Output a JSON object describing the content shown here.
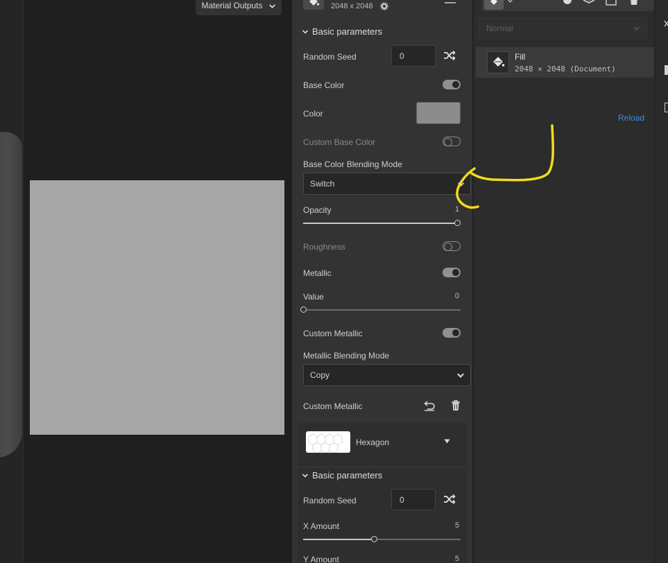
{
  "viewport": {
    "outputs_label": "Material Outputs"
  },
  "header": {
    "resolution": "2048 x 2048"
  },
  "props": {
    "basic_parameters_1": "Basic parameters",
    "random_seed_label": "Random Seed",
    "random_seed_value": "0",
    "base_color_label": "Base Color",
    "base_color_on": true,
    "color_label": "Color",
    "color_swatch": "#8c8c8c",
    "custom_base_color_label": "Custom Base Color",
    "custom_base_color_on": false,
    "base_color_blending_label": "Base Color Blending Mode",
    "base_color_blending_value": "Switch",
    "opacity_label": "Opacity",
    "opacity_value": "1",
    "opacity_fraction": 1.0,
    "roughness_label": "Roughness",
    "roughness_on": false,
    "metallic_label": "Metallic",
    "metallic_on": true,
    "value_label": "Value",
    "value_value": "0",
    "value_fraction": 0.0,
    "custom_metallic_label": "Custom Metallic",
    "custom_metallic_on": true,
    "metallic_blending_label": "Metallic Blending Mode",
    "metallic_blending_value": "Copy",
    "custom_metallic_2_label": "Custom Metallic",
    "pattern_name": "Hexagon",
    "basic_parameters_2": "Basic parameters",
    "random_seed_2_label": "Random Seed",
    "random_seed_2_value": "0",
    "x_amount_label": "X Amount",
    "x_amount_value": "5",
    "x_amount_fraction": 0.45,
    "y_amount_label": "Y Amount",
    "y_amount_value": "5"
  },
  "layers": {
    "blend_mode": "Normal",
    "layer_name": "Fill",
    "layer_detail": "2048 × 2048 (Document)",
    "reload_label": "Reload"
  },
  "colors": {
    "accent_link": "#3b8ddb",
    "annotation": "#f5dc1a",
    "panel_bg": "#333333",
    "preview_gray": "#a7a7a7"
  },
  "icons": {
    "shuffle": "shuffle-icon",
    "undo": "undo-icon",
    "trash": "trash-icon",
    "chevron": "chevron-down-icon",
    "fill": "paint-bucket-icon",
    "gear": "gear-icon"
  }
}
